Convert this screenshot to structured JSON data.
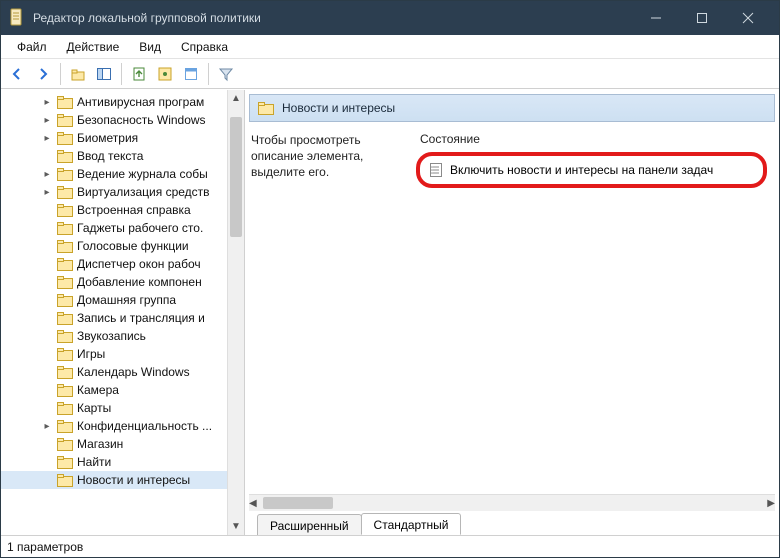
{
  "window": {
    "title": "Редактор локальной групповой политики"
  },
  "menus": {
    "file": "Файл",
    "action": "Действие",
    "view": "Вид",
    "help": "Справка"
  },
  "tree": {
    "items": [
      {
        "label": "Антивирусная програм",
        "expandable": true
      },
      {
        "label": "Безопасность Windows",
        "expandable": true
      },
      {
        "label": "Биометрия",
        "expandable": true
      },
      {
        "label": "Ввод текста",
        "expandable": false
      },
      {
        "label": "Ведение журнала собы",
        "expandable": true
      },
      {
        "label": "Виртуализация средств",
        "expandable": true
      },
      {
        "label": "Встроенная справка",
        "expandable": false
      },
      {
        "label": "Гаджеты рабочего сто.",
        "expandable": false
      },
      {
        "label": "Голосовые функции",
        "expandable": false
      },
      {
        "label": "Диспетчер окон рабоч",
        "expandable": false
      },
      {
        "label": "Добавление компонен",
        "expandable": false
      },
      {
        "label": "Домашняя группа",
        "expandable": false
      },
      {
        "label": "Запись и трансляция и",
        "expandable": false
      },
      {
        "label": "Звукозапись",
        "expandable": false
      },
      {
        "label": "Игры",
        "expandable": false
      },
      {
        "label": "Календарь Windows",
        "expandable": false
      },
      {
        "label": "Камера",
        "expandable": false
      },
      {
        "label": "Карты",
        "expandable": false
      },
      {
        "label": "Конфиденциальность ...",
        "expandable": true
      },
      {
        "label": "Магазин",
        "expandable": false
      },
      {
        "label": "Найти",
        "expandable": false
      },
      {
        "label": "Новости и интересы",
        "expandable": false,
        "selected": true
      }
    ]
  },
  "right": {
    "header": "Новости и интересы",
    "description": "Чтобы просмотреть описание элемента, выделите его.",
    "column_state": "Состояние",
    "setting_label": "Включить новости и интересы на панели задач"
  },
  "tabs": {
    "ext": "Расширенный",
    "std": "Стандартный"
  },
  "status": {
    "text": "1 параметров"
  }
}
